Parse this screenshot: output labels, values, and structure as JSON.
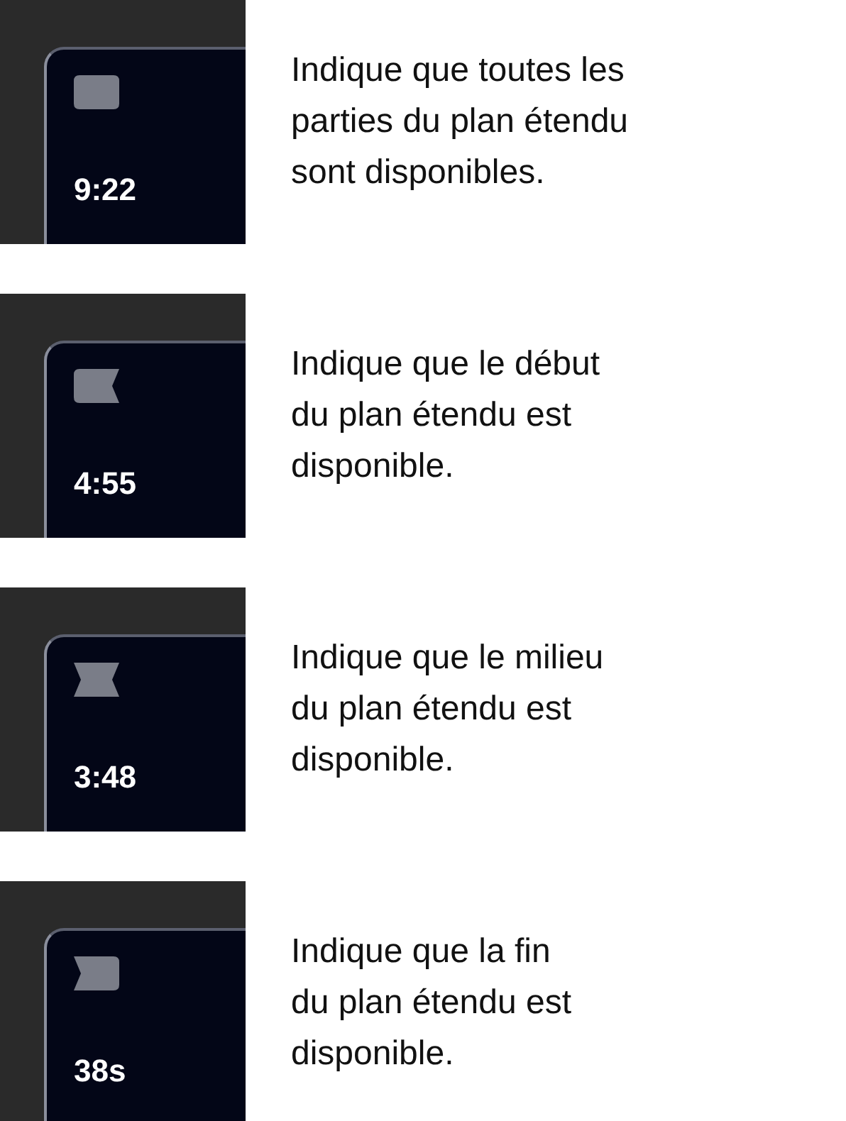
{
  "items": [
    {
      "kind": "full",
      "duration": "9:22",
      "description": "Indique que toutes les\nparties du plan étendu\nsont disponibles."
    },
    {
      "kind": "start",
      "duration": "4:55",
      "description": "Indique que le début\ndu plan étendu est\ndisponible."
    },
    {
      "kind": "middle",
      "duration": "3:48",
      "description": "Indique que le milieu\ndu plan étendu est\ndisponible."
    },
    {
      "kind": "end",
      "duration": "38s",
      "description": "Indique que la fin\ndu plan étendu est\ndisponible."
    }
  ]
}
